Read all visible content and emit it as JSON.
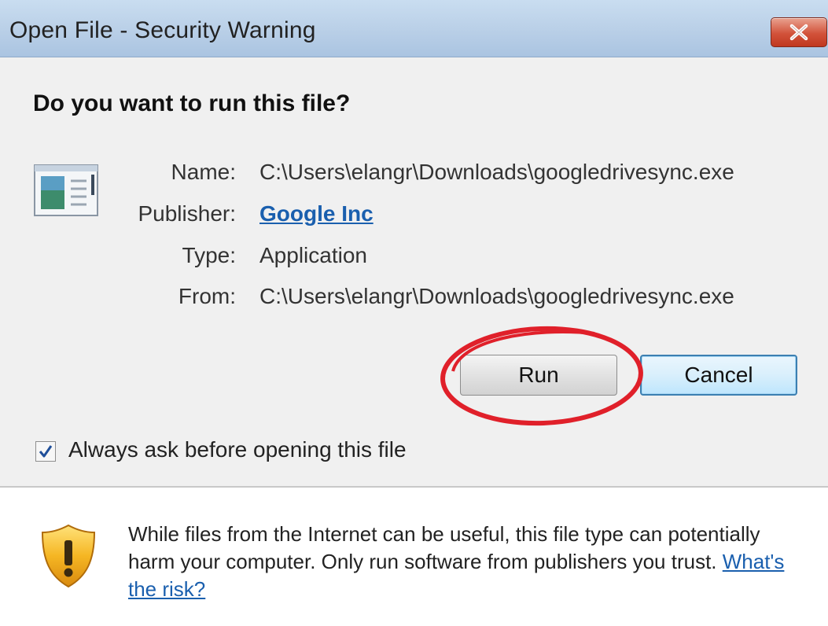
{
  "window": {
    "title": "Open File - Security Warning",
    "close_label": "X"
  },
  "dialog": {
    "question": "Do you want to run this file?",
    "fields": {
      "name_label": "Name:",
      "name_value": "C:\\Users\\elangr\\Downloads\\googledrivesync.exe",
      "publisher_label": "Publisher:",
      "publisher_value": "Google Inc",
      "type_label": "Type:",
      "type_value": "Application",
      "from_label": "From:",
      "from_value": "C:\\Users\\elangr\\Downloads\\googledrivesync.exe"
    },
    "buttons": {
      "run": "Run",
      "cancel": "Cancel"
    },
    "checkbox": {
      "label": "Always ask before opening this file",
      "checked": true
    },
    "warning": {
      "text": "While files from the Internet can be useful, this file type can potentially harm your computer. Only run software from publishers you trust.",
      "link": "What's the risk?"
    }
  },
  "icons": {
    "file": "application-file-icon",
    "shield": "security-shield-icon",
    "close": "close-icon",
    "check": "checkmark-icon"
  },
  "colors": {
    "link": "#1a5fae",
    "annotation_circle": "#e0202a",
    "close_button": "#d2523a"
  }
}
